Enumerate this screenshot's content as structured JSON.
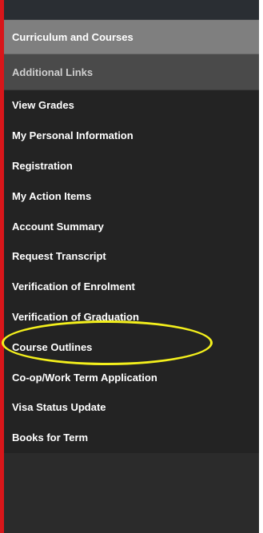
{
  "menu": {
    "header_items": [
      "Curriculum and Courses",
      "Additional Links"
    ],
    "items": [
      "View Grades",
      "My Personal Information",
      "Registration",
      "My Action Items",
      "Account Summary",
      "Request Transcript",
      "Verification of Enrolment",
      "Verification of Graduation",
      "Course Outlines",
      "Co-op/Work Term Application",
      "Visa Status Update",
      "Books for Term"
    ]
  },
  "colors": {
    "red_bar": "#d8161a",
    "panel_bg": "#232323",
    "header_primary_bg": "#7f7f7f",
    "header_secondary_bg": "#4a4a4a",
    "highlight_oval": "#f4f01c"
  }
}
